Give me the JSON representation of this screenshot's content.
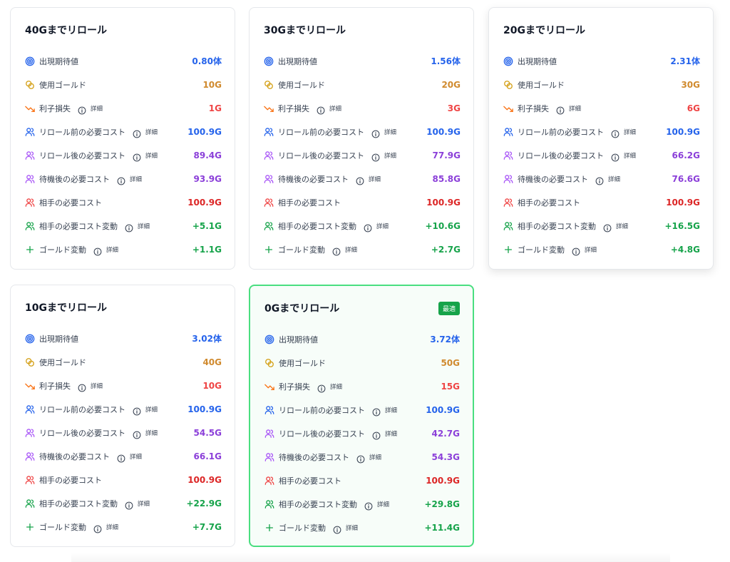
{
  "colors": {
    "blue": "#2563eb",
    "orange": "#d08a2e",
    "red": "#ef4444",
    "purple": "#8b3fd9",
    "green": "#16a34a",
    "best_border": "#4ade80"
  },
  "labels": {
    "expected": "出現期待値",
    "gold_used": "使用ゴールド",
    "interest_loss": "利子損失",
    "cost_before": "リロール前の必要コスト",
    "cost_after": "リロール後の必要コスト",
    "cost_wait": "待機後の必要コスト",
    "opp_cost": "相手の必要コスト",
    "opp_change": "相手の必要コスト変動",
    "gold_change": "ゴールド変動",
    "detail": "詳細"
  },
  "icons": {
    "expected": "target-icon",
    "gold_used": "coins-icon",
    "interest_loss": "trending-down-icon",
    "cost": "users-icon",
    "gold_change": "plus-icon",
    "info": "info-icon"
  },
  "cards": [
    {
      "title": "40Gまでリロール",
      "badge": "",
      "best": false,
      "values": {
        "expected": "0.80体",
        "gold_used": "10G",
        "interest_loss": "1G",
        "cost_before": "100.9G",
        "cost_after": "89.4G",
        "cost_wait": "93.9G",
        "opp_cost": "100.9G",
        "opp_change": "+5.1G",
        "gold_change": "+1.1G"
      }
    },
    {
      "title": "30Gまでリロール",
      "badge": "",
      "best": false,
      "values": {
        "expected": "1.56体",
        "gold_used": "20G",
        "interest_loss": "3G",
        "cost_before": "100.9G",
        "cost_after": "77.9G",
        "cost_wait": "85.8G",
        "opp_cost": "100.9G",
        "opp_change": "+10.6G",
        "gold_change": "+2.7G"
      }
    },
    {
      "title": "20Gまでリロール",
      "badge": "",
      "best": false,
      "values": {
        "expected": "2.31体",
        "gold_used": "30G",
        "interest_loss": "6G",
        "cost_before": "100.9G",
        "cost_after": "66.2G",
        "cost_wait": "76.6G",
        "opp_cost": "100.9G",
        "opp_change": "+16.5G",
        "gold_change": "+4.8G"
      }
    },
    {
      "title": "10Gまでリロール",
      "badge": "",
      "best": false,
      "values": {
        "expected": "3.02体",
        "gold_used": "40G",
        "interest_loss": "10G",
        "cost_before": "100.9G",
        "cost_after": "54.5G",
        "cost_wait": "66.1G",
        "opp_cost": "100.9G",
        "opp_change": "+22.9G",
        "gold_change": "+7.7G"
      }
    },
    {
      "title": "0Gまでリロール",
      "badge": "最適",
      "best": true,
      "values": {
        "expected": "3.72体",
        "gold_used": "50G",
        "interest_loss": "15G",
        "cost_before": "100.9G",
        "cost_after": "42.7G",
        "cost_wait": "54.3G",
        "opp_cost": "100.9G",
        "opp_change": "+29.8G",
        "gold_change": "+11.4G"
      }
    }
  ]
}
